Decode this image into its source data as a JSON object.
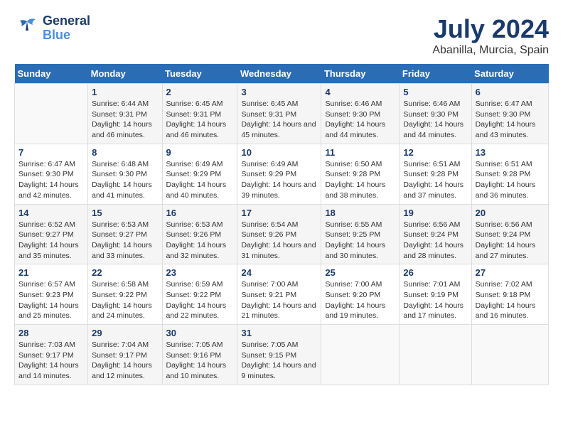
{
  "logo": {
    "line1": "General",
    "line2": "Blue"
  },
  "title": "July 2024",
  "location": "Abanilla, Murcia, Spain",
  "days_of_week": [
    "Sunday",
    "Monday",
    "Tuesday",
    "Wednesday",
    "Thursday",
    "Friday",
    "Saturday"
  ],
  "weeks": [
    [
      {
        "day": "",
        "sunrise": "",
        "sunset": "",
        "daylight": ""
      },
      {
        "day": "1",
        "sunrise": "Sunrise: 6:44 AM",
        "sunset": "Sunset: 9:31 PM",
        "daylight": "Daylight: 14 hours and 46 minutes."
      },
      {
        "day": "2",
        "sunrise": "Sunrise: 6:45 AM",
        "sunset": "Sunset: 9:31 PM",
        "daylight": "Daylight: 14 hours and 46 minutes."
      },
      {
        "day": "3",
        "sunrise": "Sunrise: 6:45 AM",
        "sunset": "Sunset: 9:31 PM",
        "daylight": "Daylight: 14 hours and 45 minutes."
      },
      {
        "day": "4",
        "sunrise": "Sunrise: 6:46 AM",
        "sunset": "Sunset: 9:30 PM",
        "daylight": "Daylight: 14 hours and 44 minutes."
      },
      {
        "day": "5",
        "sunrise": "Sunrise: 6:46 AM",
        "sunset": "Sunset: 9:30 PM",
        "daylight": "Daylight: 14 hours and 44 minutes."
      },
      {
        "day": "6",
        "sunrise": "Sunrise: 6:47 AM",
        "sunset": "Sunset: 9:30 PM",
        "daylight": "Daylight: 14 hours and 43 minutes."
      }
    ],
    [
      {
        "day": "7",
        "sunrise": "Sunrise: 6:47 AM",
        "sunset": "Sunset: 9:30 PM",
        "daylight": "Daylight: 14 hours and 42 minutes."
      },
      {
        "day": "8",
        "sunrise": "Sunrise: 6:48 AM",
        "sunset": "Sunset: 9:30 PM",
        "daylight": "Daylight: 14 hours and 41 minutes."
      },
      {
        "day": "9",
        "sunrise": "Sunrise: 6:49 AM",
        "sunset": "Sunset: 9:29 PM",
        "daylight": "Daylight: 14 hours and 40 minutes."
      },
      {
        "day": "10",
        "sunrise": "Sunrise: 6:49 AM",
        "sunset": "Sunset: 9:29 PM",
        "daylight": "Daylight: 14 hours and 39 minutes."
      },
      {
        "day": "11",
        "sunrise": "Sunrise: 6:50 AM",
        "sunset": "Sunset: 9:28 PM",
        "daylight": "Daylight: 14 hours and 38 minutes."
      },
      {
        "day": "12",
        "sunrise": "Sunrise: 6:51 AM",
        "sunset": "Sunset: 9:28 PM",
        "daylight": "Daylight: 14 hours and 37 minutes."
      },
      {
        "day": "13",
        "sunrise": "Sunrise: 6:51 AM",
        "sunset": "Sunset: 9:28 PM",
        "daylight": "Daylight: 14 hours and 36 minutes."
      }
    ],
    [
      {
        "day": "14",
        "sunrise": "Sunrise: 6:52 AM",
        "sunset": "Sunset: 9:27 PM",
        "daylight": "Daylight: 14 hours and 35 minutes."
      },
      {
        "day": "15",
        "sunrise": "Sunrise: 6:53 AM",
        "sunset": "Sunset: 9:27 PM",
        "daylight": "Daylight: 14 hours and 33 minutes."
      },
      {
        "day": "16",
        "sunrise": "Sunrise: 6:53 AM",
        "sunset": "Sunset: 9:26 PM",
        "daylight": "Daylight: 14 hours and 32 minutes."
      },
      {
        "day": "17",
        "sunrise": "Sunrise: 6:54 AM",
        "sunset": "Sunset: 9:26 PM",
        "daylight": "Daylight: 14 hours and 31 minutes."
      },
      {
        "day": "18",
        "sunrise": "Sunrise: 6:55 AM",
        "sunset": "Sunset: 9:25 PM",
        "daylight": "Daylight: 14 hours and 30 minutes."
      },
      {
        "day": "19",
        "sunrise": "Sunrise: 6:56 AM",
        "sunset": "Sunset: 9:24 PM",
        "daylight": "Daylight: 14 hours and 28 minutes."
      },
      {
        "day": "20",
        "sunrise": "Sunrise: 6:56 AM",
        "sunset": "Sunset: 9:24 PM",
        "daylight": "Daylight: 14 hours and 27 minutes."
      }
    ],
    [
      {
        "day": "21",
        "sunrise": "Sunrise: 6:57 AM",
        "sunset": "Sunset: 9:23 PM",
        "daylight": "Daylight: 14 hours and 25 minutes."
      },
      {
        "day": "22",
        "sunrise": "Sunrise: 6:58 AM",
        "sunset": "Sunset: 9:22 PM",
        "daylight": "Daylight: 14 hours and 24 minutes."
      },
      {
        "day": "23",
        "sunrise": "Sunrise: 6:59 AM",
        "sunset": "Sunset: 9:22 PM",
        "daylight": "Daylight: 14 hours and 22 minutes."
      },
      {
        "day": "24",
        "sunrise": "Sunrise: 7:00 AM",
        "sunset": "Sunset: 9:21 PM",
        "daylight": "Daylight: 14 hours and 21 minutes."
      },
      {
        "day": "25",
        "sunrise": "Sunrise: 7:00 AM",
        "sunset": "Sunset: 9:20 PM",
        "daylight": "Daylight: 14 hours and 19 minutes."
      },
      {
        "day": "26",
        "sunrise": "Sunrise: 7:01 AM",
        "sunset": "Sunset: 9:19 PM",
        "daylight": "Daylight: 14 hours and 17 minutes."
      },
      {
        "day": "27",
        "sunrise": "Sunrise: 7:02 AM",
        "sunset": "Sunset: 9:18 PM",
        "daylight": "Daylight: 14 hours and 16 minutes."
      }
    ],
    [
      {
        "day": "28",
        "sunrise": "Sunrise: 7:03 AM",
        "sunset": "Sunset: 9:17 PM",
        "daylight": "Daylight: 14 hours and 14 minutes."
      },
      {
        "day": "29",
        "sunrise": "Sunrise: 7:04 AM",
        "sunset": "Sunset: 9:17 PM",
        "daylight": "Daylight: 14 hours and 12 minutes."
      },
      {
        "day": "30",
        "sunrise": "Sunrise: 7:05 AM",
        "sunset": "Sunset: 9:16 PM",
        "daylight": "Daylight: 14 hours and 10 minutes."
      },
      {
        "day": "31",
        "sunrise": "Sunrise: 7:05 AM",
        "sunset": "Sunset: 9:15 PM",
        "daylight": "Daylight: 14 hours and 9 minutes."
      },
      {
        "day": "",
        "sunrise": "",
        "sunset": "",
        "daylight": ""
      },
      {
        "day": "",
        "sunrise": "",
        "sunset": "",
        "daylight": ""
      },
      {
        "day": "",
        "sunrise": "",
        "sunset": "",
        "daylight": ""
      }
    ]
  ]
}
